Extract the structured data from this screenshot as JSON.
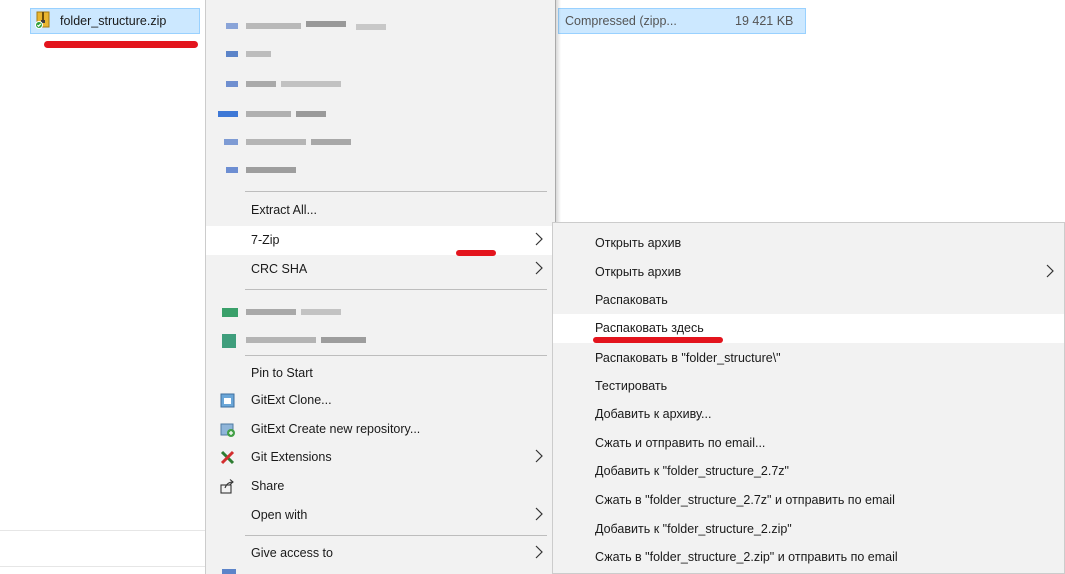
{
  "file": {
    "name": "folder_structure.zip",
    "type": "Compressed (zipp...",
    "size": "19 421 KB"
  },
  "menu": {
    "items": [
      {
        "label": "Extract All...",
        "has_submenu": false,
        "icon": ""
      },
      {
        "label": "7-Zip",
        "has_submenu": true,
        "icon": "",
        "highlighted": true
      },
      {
        "label": "CRC SHA",
        "has_submenu": true,
        "icon": ""
      },
      {
        "label": "Pin to Start",
        "has_submenu": false,
        "icon": ""
      },
      {
        "label": "GitExt Clone...",
        "has_submenu": false,
        "icon": "gitext-clone-icon"
      },
      {
        "label": "GitExt Create new repository...",
        "has_submenu": false,
        "icon": "gitext-create-icon"
      },
      {
        "label": "Git Extensions",
        "has_submenu": true,
        "icon": "git-extensions-icon"
      },
      {
        "label": "Share",
        "has_submenu": false,
        "icon": "share-icon"
      },
      {
        "label": "Open with",
        "has_submenu": true,
        "icon": ""
      },
      {
        "label": "Give access to",
        "has_submenu": true,
        "icon": ""
      }
    ]
  },
  "submenu": {
    "items": [
      {
        "label": "Открыть архив",
        "has_submenu": false
      },
      {
        "label": "Открыть архив",
        "has_submenu": true
      },
      {
        "label": "Распаковать",
        "has_submenu": false
      },
      {
        "label": "Распаковать здесь",
        "has_submenu": false,
        "highlighted": true
      },
      {
        "label": "Распаковать в \"folder_structure\\\"",
        "has_submenu": false
      },
      {
        "label": "Тестировать",
        "has_submenu": false
      },
      {
        "label": "Добавить к архиву...",
        "has_submenu": false
      },
      {
        "label": "Сжать и отправить по email...",
        "has_submenu": false
      },
      {
        "label": "Добавить к \"folder_structure_2.7z\"",
        "has_submenu": false
      },
      {
        "label": "Сжать в \"folder_structure_2.7z\" и отправить по email",
        "has_submenu": false
      },
      {
        "label": "Добавить к \"folder_structure_2.zip\"",
        "has_submenu": false
      },
      {
        "label": "Сжать в \"folder_structure_2.zip\" и отправить по email",
        "has_submenu": false
      }
    ]
  },
  "colors": {
    "selection": "#cce8ff",
    "menu_bg": "#f2f2f2",
    "annotation": "#e3141d"
  }
}
